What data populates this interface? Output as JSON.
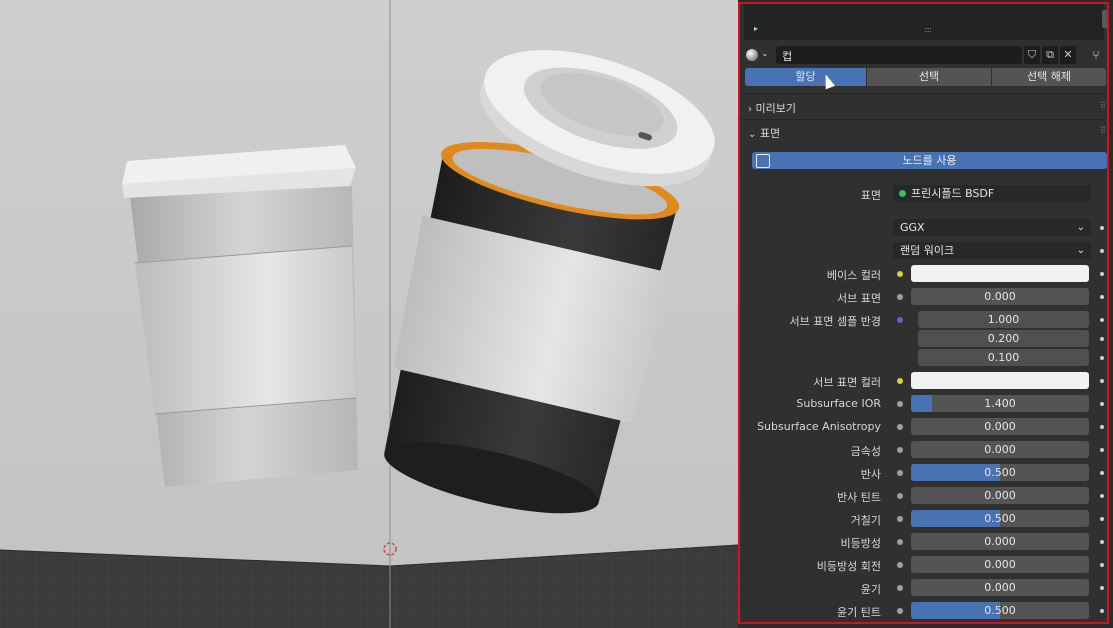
{
  "material": {
    "name": "컵",
    "tabs": [
      "할당",
      "선택",
      "선택 해제"
    ]
  },
  "sections": {
    "preview": "미리보기",
    "surface": "표면"
  },
  "use_nodes": "노드를 사용",
  "surface_shader": {
    "label": "표면",
    "value": "프린시플드 BSDF"
  },
  "distribution": "GGX",
  "subsurface_method": "랜덤 워이크",
  "properties": [
    {
      "label": "베이스 컬러",
      "value": "",
      "fill": 0,
      "socket_color": "#d6d23a",
      "type": "color"
    },
    {
      "label": "서브 표면",
      "value": "0.000",
      "fill": 0,
      "socket_color": "#a0a0a0",
      "type": "number"
    },
    {
      "label": "서브 표면 셈플 반경",
      "value": "1.000",
      "fill": 0,
      "socket_color": "#6363c7",
      "type": "vector"
    },
    {
      "label": "",
      "value": "0.200",
      "fill": 0,
      "type": "vector-sub"
    },
    {
      "label": "",
      "value": "0.100",
      "fill": 0,
      "type": "vector-sub"
    },
    {
      "label": "서브 표면 컬러",
      "value": "",
      "fill": 0,
      "socket_color": "#d6d23a",
      "type": "color"
    },
    {
      "label": "Subsurface IOR",
      "value": "1.400",
      "fill": 0.12,
      "socket_color": "#a0a0a0",
      "type": "number"
    },
    {
      "label": "Subsurface Anisotropy",
      "value": "0.000",
      "fill": 0,
      "socket_color": "#a0a0a0",
      "type": "number"
    },
    {
      "label": "금속성",
      "value": "0.000",
      "fill": 0,
      "socket_color": "#a0a0a0",
      "type": "number"
    },
    {
      "label": "반사",
      "value": "0.500",
      "fill": 0.5,
      "socket_color": "#a0a0a0",
      "type": "number"
    },
    {
      "label": "반사 틴트",
      "value": "0.000",
      "fill": 0,
      "socket_color": "#a0a0a0",
      "type": "number"
    },
    {
      "label": "거칠기",
      "value": "0.500",
      "fill": 0.5,
      "socket_color": "#a0a0a0",
      "type": "number"
    },
    {
      "label": "비등방성",
      "value": "0.000",
      "fill": 0,
      "socket_color": "#a0a0a0",
      "type": "number"
    },
    {
      "label": "비등방성 회전",
      "value": "0.000",
      "fill": 0,
      "socket_color": "#a0a0a0",
      "type": "number"
    },
    {
      "label": "윤기",
      "value": "0.000",
      "fill": 0,
      "socket_color": "#a0a0a0",
      "type": "number"
    },
    {
      "label": "윤기 틴트",
      "value": "0.500",
      "fill": 0.5,
      "socket_color": "#a0a0a0",
      "type": "number"
    }
  ],
  "colors": {
    "accent": "#4772b3",
    "highlight_border": "#d0141e",
    "selection_orange": "#e08a1e"
  }
}
